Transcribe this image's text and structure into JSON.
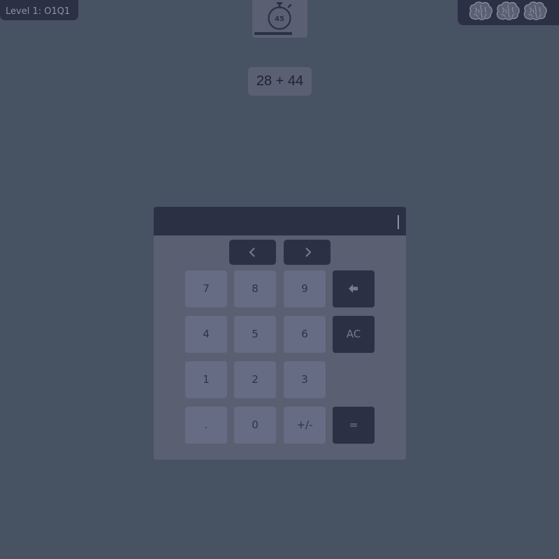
{
  "header": {
    "level_label": "Level 1: O1Q1",
    "timer_value": "45",
    "lives": [
      "brain-icon",
      "brain-icon",
      "brain-icon"
    ]
  },
  "problem": {
    "expression": "28 + 44"
  },
  "calculator": {
    "display_value": "",
    "keys": {
      "seven": "7",
      "eight": "8",
      "nine": "9",
      "four": "4",
      "five": "5",
      "six": "6",
      "clear": "AC",
      "one": "1",
      "two": "2",
      "three": "3",
      "decimal": ".",
      "zero": "0",
      "sign": "+/-",
      "equals": "="
    }
  },
  "colors": {
    "background": "#475262",
    "panel": "#5a5f72",
    "dark": "#2b3045",
    "key": "#656c83"
  }
}
